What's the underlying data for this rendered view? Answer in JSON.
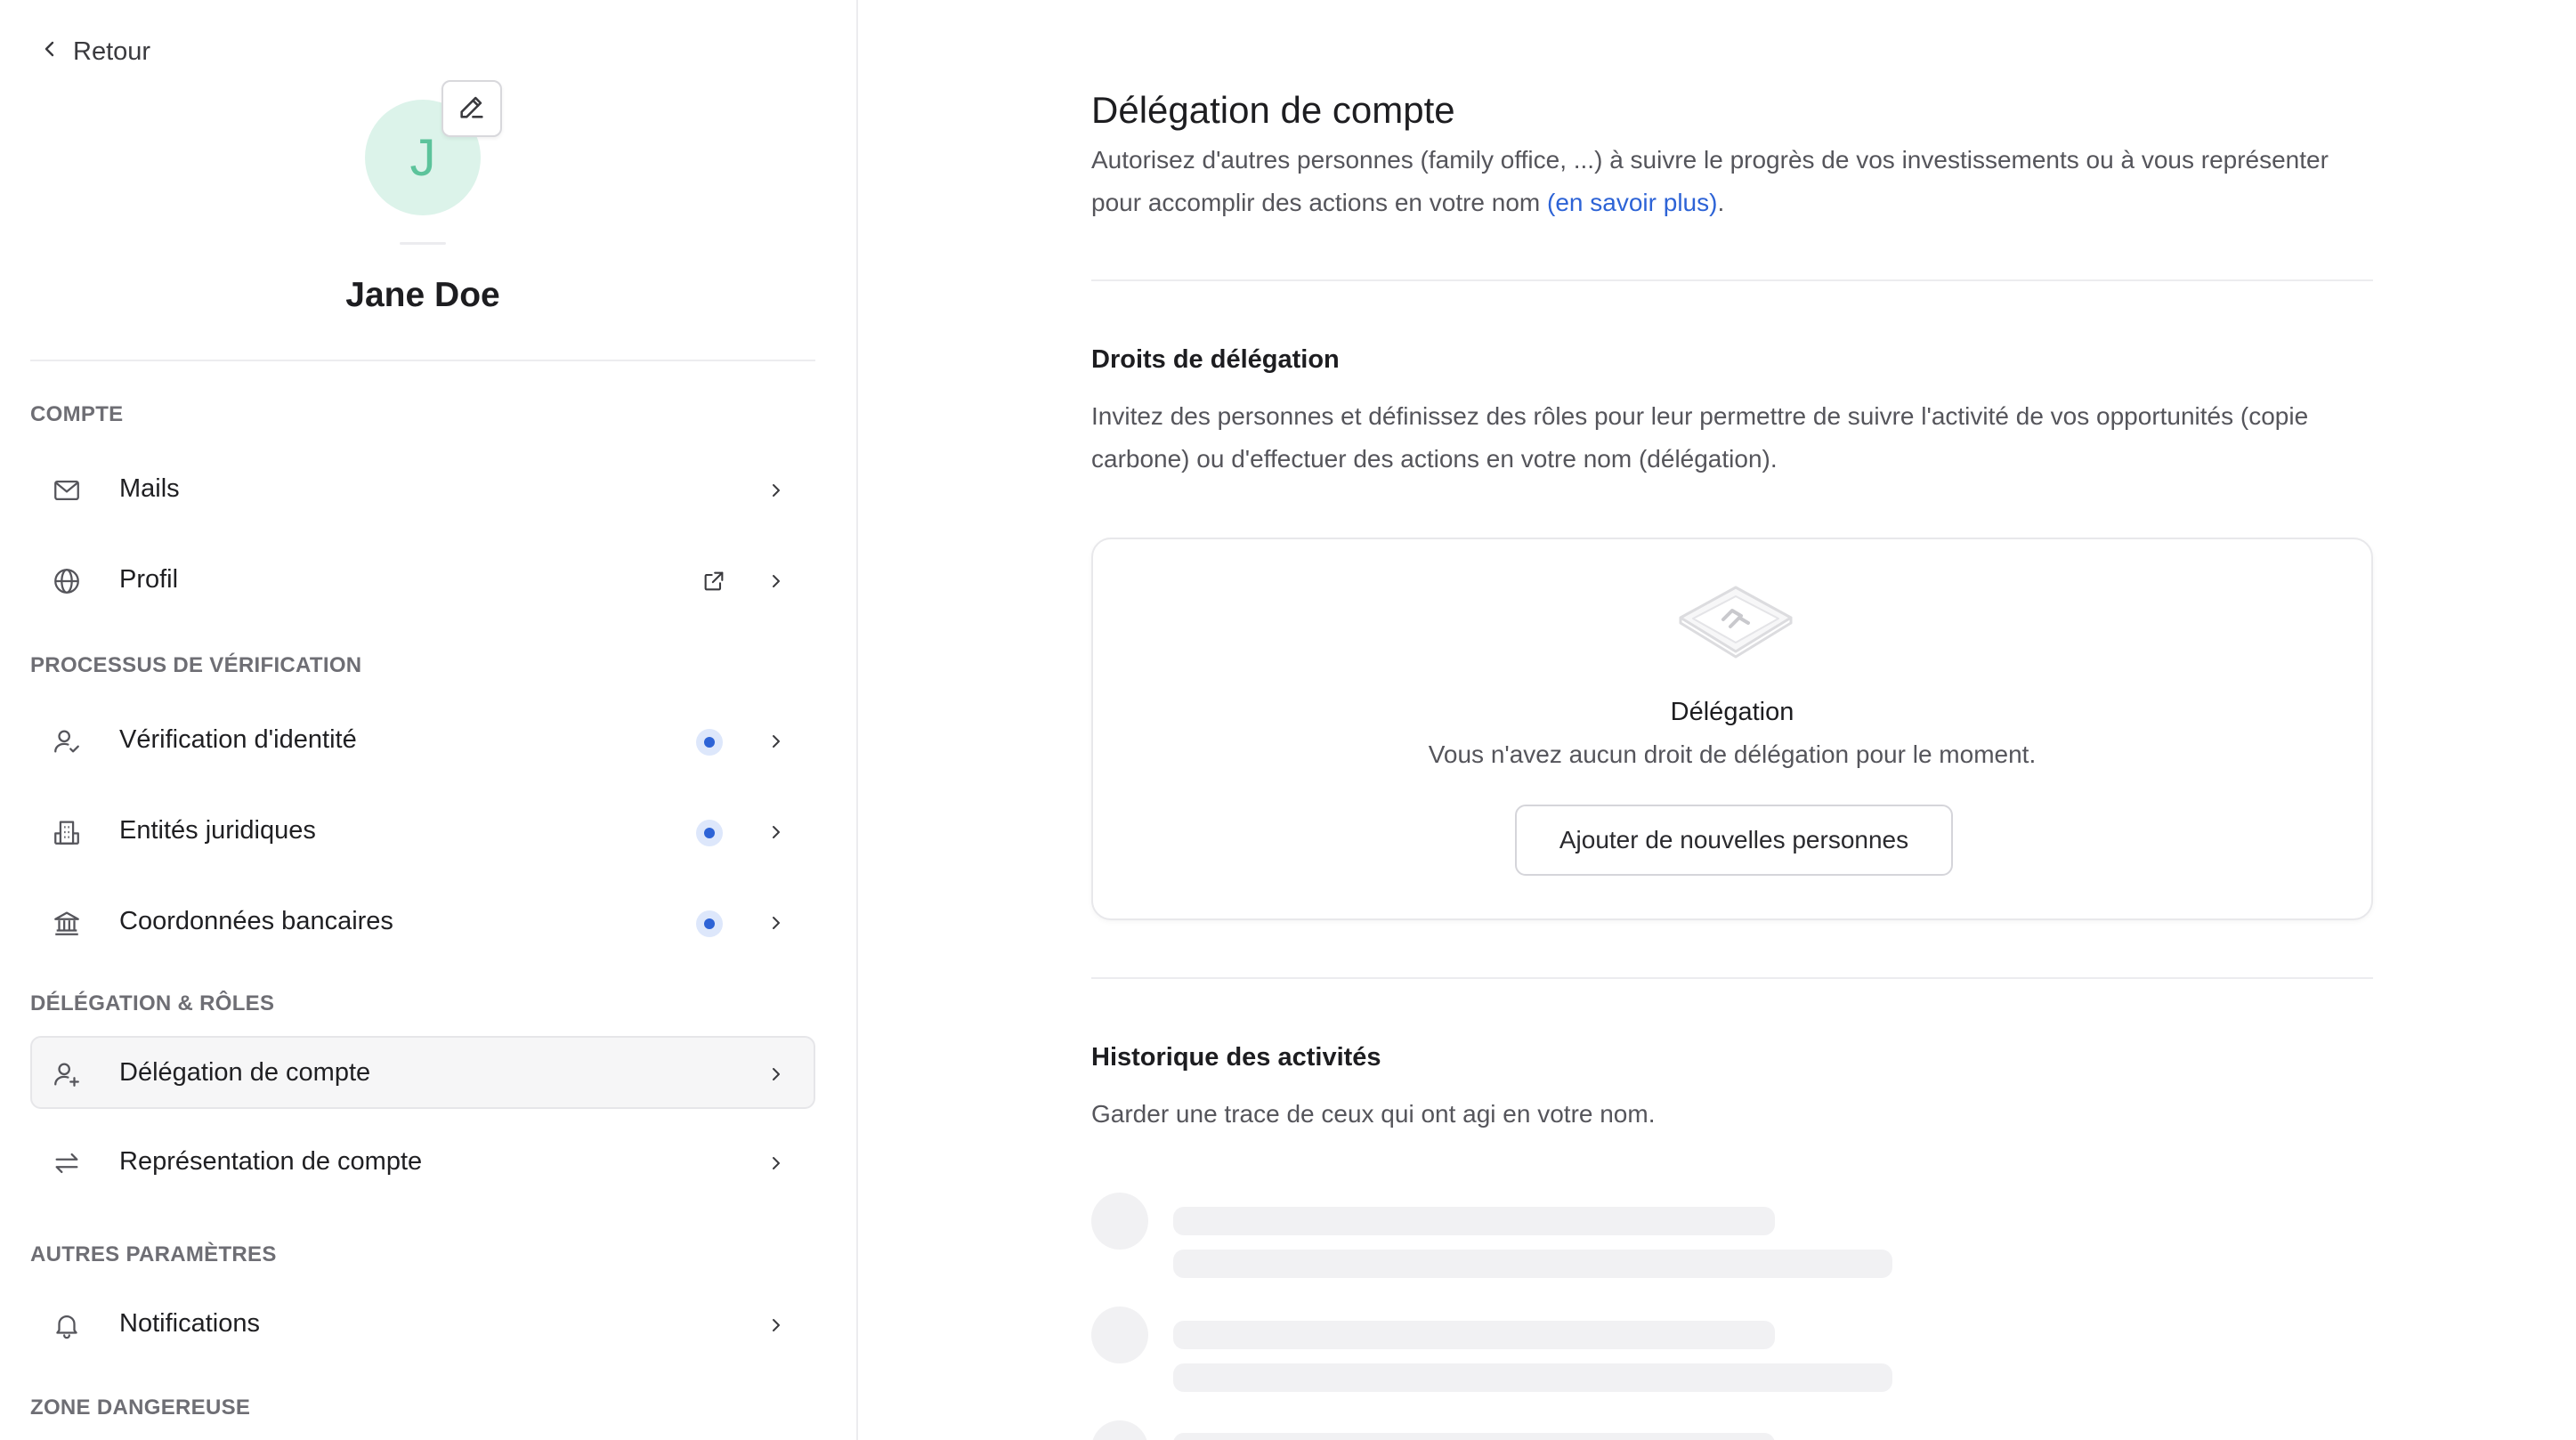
{
  "sidebar": {
    "back_label": "Retour",
    "avatar_initial": "J",
    "user_name": "Jane Doe",
    "sections": {
      "account": "COMPTE",
      "verification": "PROCESSUS DE VÉRIFICATION",
      "delegation": "DÉLÉGATION & RÔLES",
      "other": "AUTRES PARAMÈTRES",
      "danger": "ZONE DANGEREUSE"
    },
    "items": [
      {
        "label": "Mails",
        "icon": "mail-icon"
      },
      {
        "label": "Profil",
        "icon": "globe-icon",
        "external": true
      },
      {
        "label": "Vérification d'identité",
        "icon": "user-check-icon",
        "status_dot": true
      },
      {
        "label": "Entités juridiques",
        "icon": "building-icon",
        "status_dot": true
      },
      {
        "label": "Coordonnées bancaires",
        "icon": "bank-icon",
        "status_dot": true
      },
      {
        "label": "Délégation de compte",
        "icon": "user-plus-icon",
        "active": true
      },
      {
        "label": "Représentation de compte",
        "icon": "arrows-swap-icon"
      },
      {
        "label": "Notifications",
        "icon": "bell-icon"
      }
    ]
  },
  "main": {
    "title": "Délégation de compte",
    "description": "Autorisez d'autres personnes (family office, ...) à suivre le progrès de vos investissements ou à vous représenter pour accomplir des actions en votre nom ",
    "learn_more": "(en savoir plus)",
    "description_end": ".",
    "rights": {
      "title": "Droits de délégation",
      "description": "Invitez des personnes et définissez des rôles pour leur permettre de suivre l'activité de vos opportunités (copie carbone) ou d'effectuer des actions en votre nom (délégation).",
      "empty_title": "Délégation",
      "empty_description": "Vous n'avez aucun droit de délégation pour le moment.",
      "add_button": "Ajouter de nouvelles personnes"
    },
    "history": {
      "title": "Historique des activités",
      "description": "Garder une trace de ceux qui ont agi en votre nom."
    }
  },
  "colors": {
    "accent": "#2d63d6",
    "avatar_bg": "#dcf3ea",
    "avatar_fg": "#5cc39b",
    "skeleton": "#f1f1f3"
  }
}
